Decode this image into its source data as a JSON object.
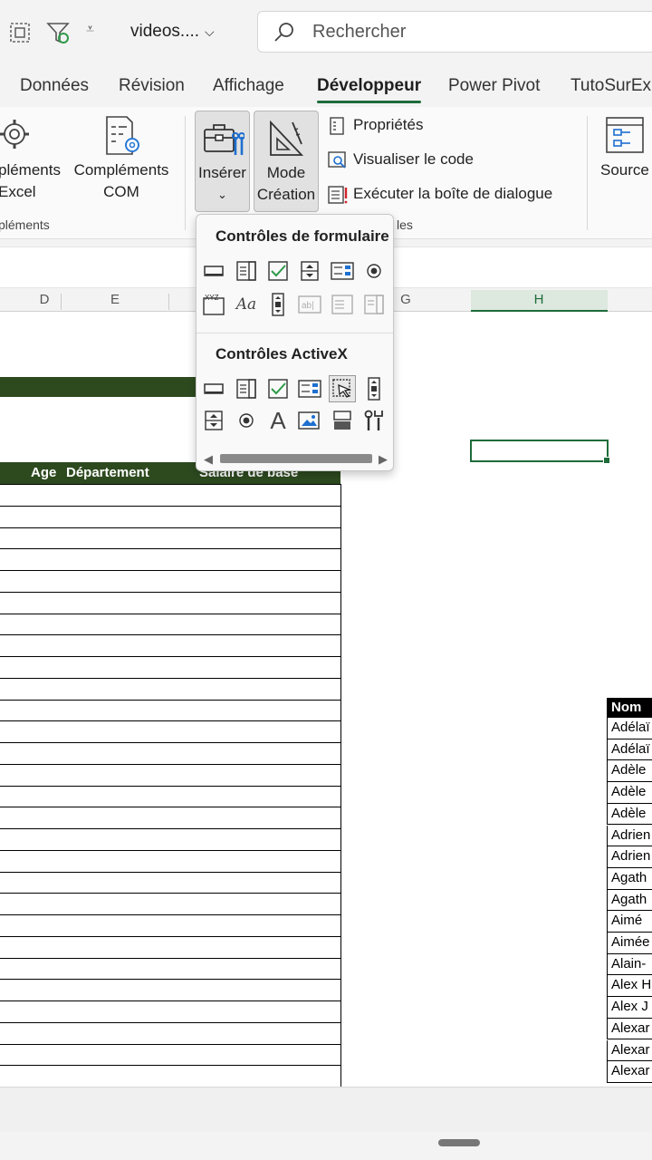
{
  "titlebar": {
    "filename": "videos....",
    "search_placeholder": "Rechercher"
  },
  "tabs": [
    "Données",
    "Révision",
    "Affichage",
    "Développeur",
    "Power Pivot",
    "TutoSurEx"
  ],
  "active_tab": "Développeur",
  "ribbon": {
    "addins_excel_line1": "pléments",
    "addins_excel_line2": "Excel",
    "addins_com_line1": "Compléments",
    "addins_com_line2": "COM",
    "group_addins": "pléments",
    "insert_label": "Insérer",
    "design_mode_line1": "Mode",
    "design_mode_line2": "Création",
    "properties": "Propriétés",
    "view_code": "Visualiser le code",
    "run_dialog": "Exécuter la boîte de dialogue",
    "group_controls": "les",
    "source": "Source"
  },
  "dropdown": {
    "form_controls_title": "Contrôles de formulaire",
    "activex_title": "Contrôles ActiveX"
  },
  "columns": [
    "D",
    "E",
    "G",
    "H"
  ],
  "table_headers": {
    "age": "Age",
    "department": "Département",
    "salary": "Salaire de base"
  },
  "names_header": "Nom",
  "names": [
    "Adélaï",
    "Adélaï",
    "Adèle",
    "Adèle",
    "Adèle",
    "Adrien",
    "Adrien",
    "Agath",
    "Agath",
    "Aimé",
    "Aimée",
    "Alain-",
    "Alex H",
    "Alex J",
    "Alexar",
    "Alexar",
    "Alexar"
  ]
}
